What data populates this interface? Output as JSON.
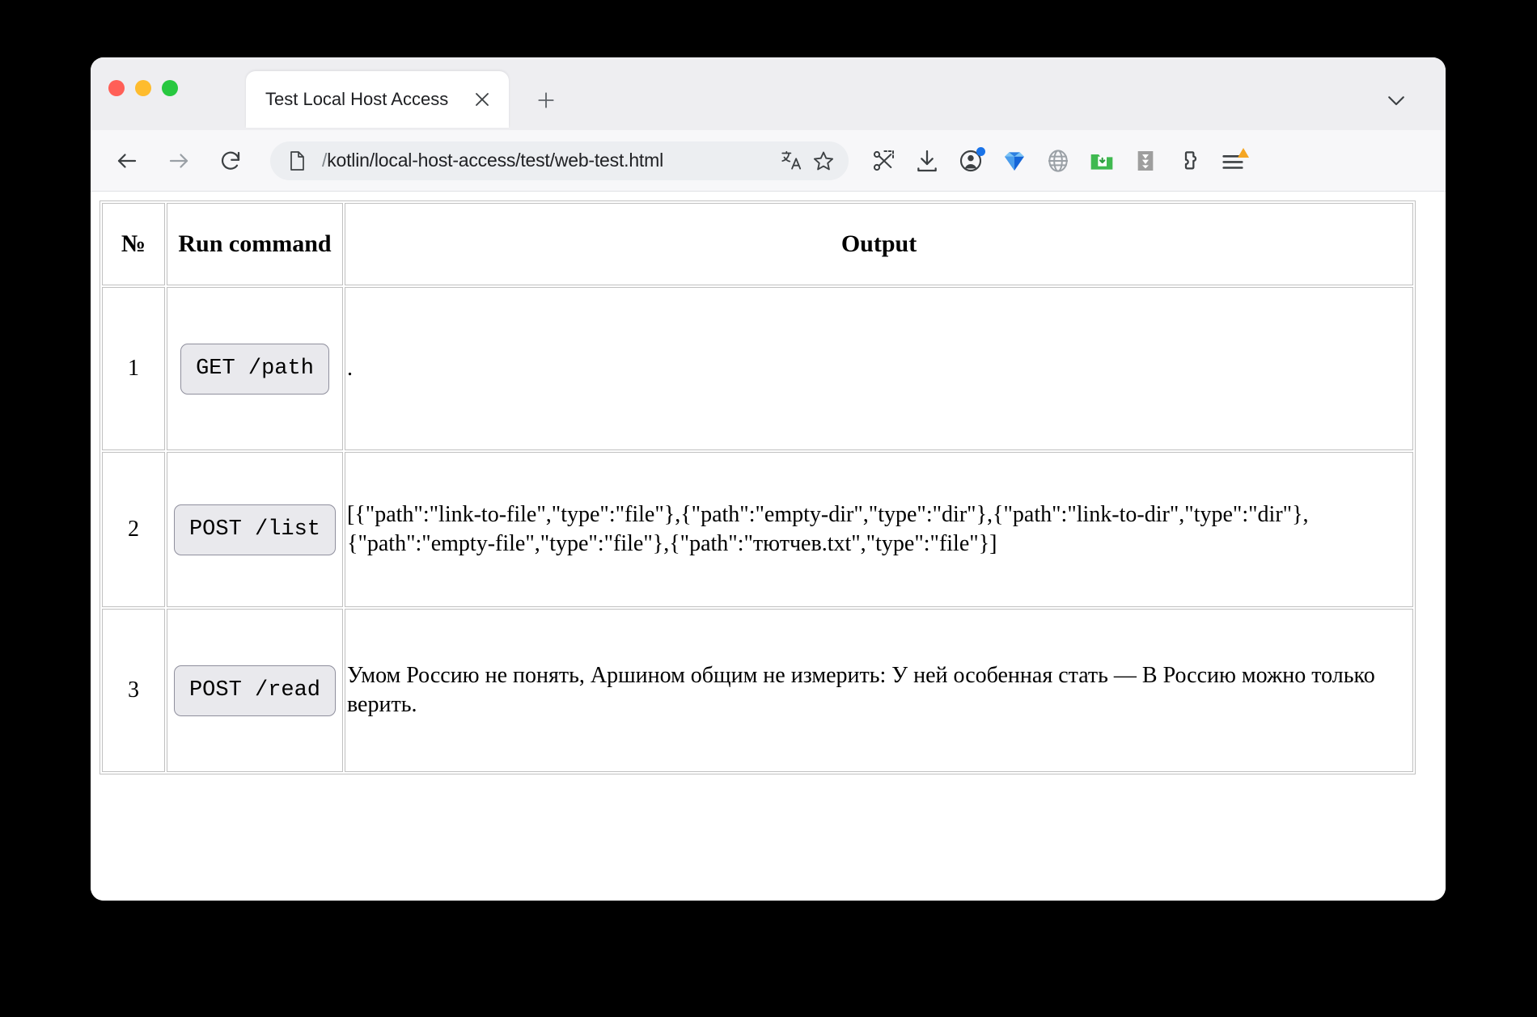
{
  "window": {
    "traffic_lights": [
      "close",
      "minimize",
      "maximize"
    ],
    "colors": {
      "red": "#ff5f57",
      "yellow": "#febc2e",
      "green": "#28c840",
      "accent_blue": "#1a73e8",
      "toolbar_bg": "#f7f7f9",
      "tabstrip_bg": "#eeeef1",
      "omnibox_bg": "#eceef1",
      "table_border": "#c0c0c0",
      "button_bg": "#e9e9ed"
    }
  },
  "tabstrip": {
    "tab_title": "Test Local Host Access",
    "close_label": "✕",
    "new_tab_label": "+",
    "tab_list_label": "⌄"
  },
  "toolbar": {
    "back_label": "←",
    "forward_label": "→",
    "reload_label": "⟳",
    "url_prefix": "/",
    "url": "kotlin/local-host-access/test/web-test.html",
    "url_full": "/kotlin/local-host-access/test/web-test.html",
    "translate_label": "文A",
    "bookmark_label": "☆",
    "extensions": [
      "screenshot-capture-icon",
      "download-icon",
      "profile-icon",
      "gem-icon",
      "globe-icon",
      "save-folder-icon",
      "download-manager-icon",
      "puzzle-extensions-icon",
      "browser-menu-icon"
    ]
  },
  "table": {
    "headers": [
      "№",
      "Run command",
      "Output"
    ],
    "rows": [
      {
        "num": "1",
        "command": "GET /path",
        "output": "."
      },
      {
        "num": "2",
        "command": "POST /list",
        "output": "[{\"path\":\"link-to-file\",\"type\":\"file\"},{\"path\":\"empty-dir\",\"type\":\"dir\"},{\"path\":\"link-to-dir\",\"type\":\"dir\"},{\"path\":\"empty-file\",\"type\":\"file\"},{\"path\":\"тютчев.txt\",\"type\":\"file\"}]"
      },
      {
        "num": "3",
        "command": "POST /read",
        "output": "Умом Россию не понять, Аршином общим не измерить: У ней особенная стать — В Россию можно только верить."
      }
    ]
  }
}
